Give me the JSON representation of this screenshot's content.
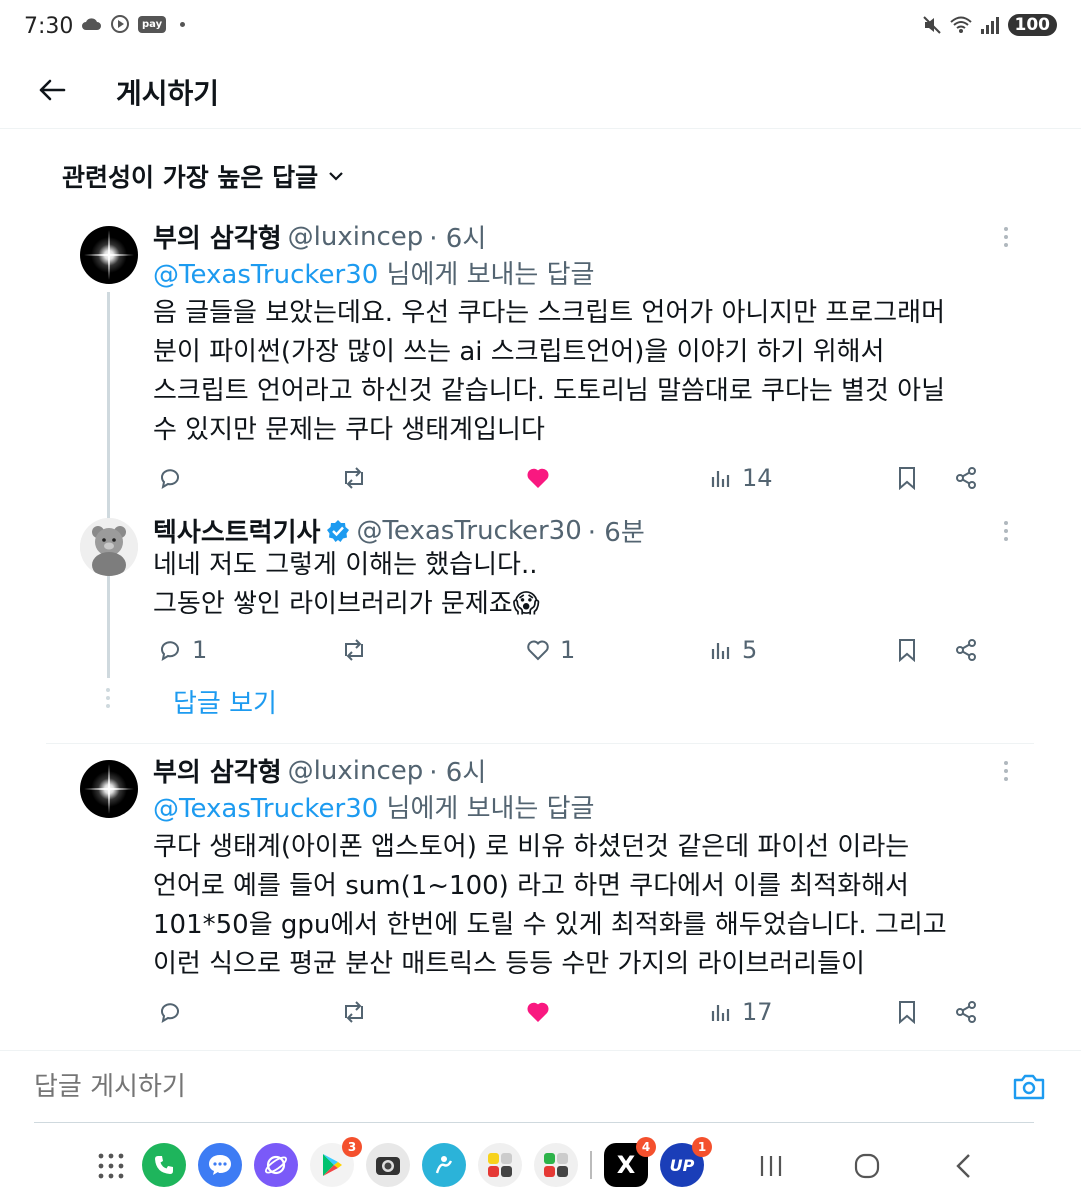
{
  "status_bar": {
    "time": "7:30",
    "pay_label": "pay",
    "battery": "100"
  },
  "header": {
    "title": "게시하기"
  },
  "sort": {
    "label": "관련성이 가장 높은 답글"
  },
  "tweets": [
    {
      "display_name": "부의 삼각형",
      "handle": "@luxincep",
      "time": "· 6시",
      "reply_mention": "@TexasTrucker30",
      "reply_suffix": " 님에게 보내는 답글",
      "text_lines": [
        "음 글들을 보았는데요. 우선 쿠다는 스크립트 언어가 아니지만 프로그래머",
        "분이 파이썬(가장 많이 쓰는 ai 스크립트언어)을 이야기 하기 위해서",
        "스크립트 언어라고 하신것 같습니다. 도토리님 말씀대로 쿠다는 별것 아닐",
        "수 있지만 문제는 쿠다 생태계입니다"
      ],
      "replies": "",
      "retweets": "",
      "likes": "",
      "liked": true,
      "views": "14"
    },
    {
      "display_name": "텍사스트럭기사",
      "verified": true,
      "handle": "@TexasTrucker30",
      "time": "· 6분",
      "text_lines": [
        "네네 저도 그렇게 이해는 했습니다..",
        "그동안 쌓인 라이브러리가 문제죠😱"
      ],
      "replies": "1",
      "retweets": "",
      "likes": "1",
      "liked": false,
      "views": "5"
    },
    {
      "display_name": "부의 삼각형",
      "handle": "@luxincep",
      "time": "· 6시",
      "reply_mention": "@TexasTrucker30",
      "reply_suffix": " 님에게 보내는 답글",
      "text_lines": [
        "쿠다 생태계(아이폰 앱스토어) 로 비유 하셨던것 같은데 파이선 이라는",
        "언어로 예를 들어 sum(1~100) 라고 하면 쿠다에서 이를 최적화해서",
        "101*50을 gpu에서 한번에 도릴 수 있게 최적화를 해두었습니다. 그리고",
        "이런 식으로 평균 분산 매트릭스 등등 수만 가지의 라이브러리들이"
      ],
      "replies": "",
      "retweets": "",
      "likes": "",
      "liked": true,
      "views": "17"
    }
  ],
  "show_replies_label": "답글 보기",
  "composer": {
    "placeholder": "답글 게시하기"
  },
  "taskbar": {
    "play_store_badge": "3",
    "x_badge": "4",
    "upbit_badge": "1",
    "upbit_label": "UP",
    "x_label": "X"
  },
  "colors": {
    "accent": "#1d9bf0",
    "like": "#f91880",
    "secondary_text": "#536471",
    "divider": "#eff3f4"
  },
  "icons": [
    "arrow-left-icon",
    "chevron-down-icon",
    "more-vertical-icon",
    "reply-icon",
    "retweet-icon",
    "heart-icon",
    "views-icon",
    "bookmark-icon",
    "share-icon",
    "verified-icon",
    "camera-icon"
  ]
}
